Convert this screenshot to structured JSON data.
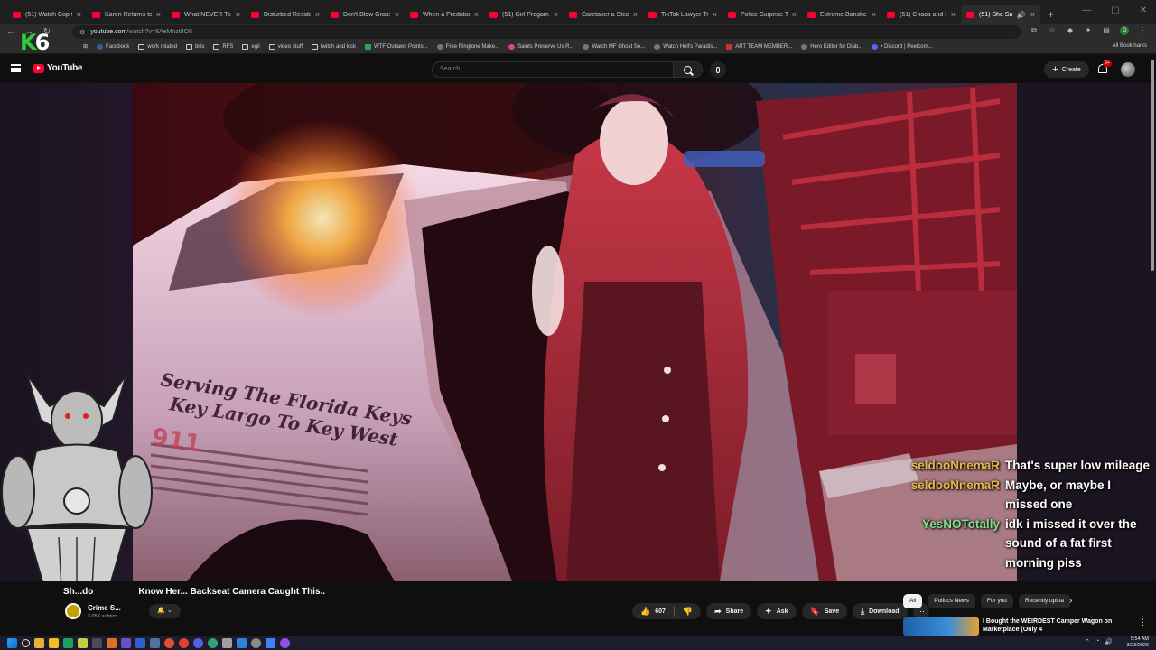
{
  "browser": {
    "tabs": [
      {
        "title": "(51) Watch Cop Cars",
        "active": false
      },
      {
        "title": "Karen Returns to the",
        "active": false
      },
      {
        "title": "What NEVER To Do",
        "active": false
      },
      {
        "title": "Disturbed Resident",
        "active": false
      },
      {
        "title": "Don't Blow Grass C",
        "active": false
      },
      {
        "title": "When a Predator Gr",
        "active": false
      },
      {
        "title": "(51) Girl Pregames",
        "active": false
      },
      {
        "title": "Caretaker a Steals",
        "active": false
      },
      {
        "title": "TikTok Lawyer Tries",
        "active": false
      },
      {
        "title": "Police Surprise Tow",
        "active": false
      },
      {
        "title": "Extreme Banshee K",
        "active": false
      },
      {
        "title": "(51) Chaos and Kare",
        "active": false
      },
      {
        "title": "(51) She Said Sh",
        "active": true
      }
    ],
    "url_domain": "youtube.com",
    "url_path": "/watch?v=8AeMnzt8O8",
    "bookmarks": [
      {
        "label": "Facebook",
        "icon": "facebook-icon",
        "color": "blue"
      },
      {
        "label": "work related",
        "icon": "folder-icon",
        "color": "folder"
      },
      {
        "label": "bills",
        "icon": "folder-icon",
        "color": "folder"
      },
      {
        "label": "RFS",
        "icon": "folder-icon",
        "color": "folder"
      },
      {
        "label": "egil",
        "icon": "folder-icon",
        "color": "folder"
      },
      {
        "label": "video stuff",
        "icon": "folder-icon",
        "color": "folder"
      },
      {
        "label": "twitch and kick",
        "icon": "folder-icon",
        "color": "folder"
      },
      {
        "label": "WTF Outlaws Points...",
        "icon": "site-icon",
        "color": "green"
      },
      {
        "label": "Free Ringtone Make...",
        "icon": "site-icon",
        "color": "gray"
      },
      {
        "label": "Saints Preserve Us R...",
        "icon": "site-icon",
        "color": "pink"
      },
      {
        "label": "Watch MF Ghost Se...",
        "icon": "site-icon",
        "color": "gray"
      },
      {
        "label": "Watch Hell's Paradis...",
        "icon": "site-icon",
        "color": "gray"
      },
      {
        "label": "ART TEAM MEMBER...",
        "icon": "site-icon",
        "color": "red"
      },
      {
        "label": "Hero Editor for Diab...",
        "icon": "site-icon",
        "color": "gray"
      },
      {
        "label": "• Discord | Peelcom...",
        "icon": "discord-icon",
        "color": "purple"
      }
    ],
    "all_bookmarks_label": "All Bookmarks",
    "profile_initial": "G"
  },
  "overlay": {
    "badge_k": "K",
    "badge_6": "6"
  },
  "youtube": {
    "logo_text": "YouTube",
    "search_placeholder": "Search",
    "create_label": "Create",
    "notif_count": "9+"
  },
  "video": {
    "car_text_line1": "Serving The Florida Keys",
    "car_text_line2": "Key Largo To Key West",
    "car_number": "911",
    "title_prefix": "Sh...do",
    "title_suffix": "Know Her... Backseat Camera Caught This..",
    "channel_name": "Crime S...",
    "channel_subs": "3.05K subscri...",
    "likes": "607",
    "share_label": "Share",
    "ask_label": "Ask",
    "save_label": "Save",
    "download_label": "Download"
  },
  "chat": [
    {
      "user": "seldooNnemaR",
      "color": "#e8b84a",
      "text": "That's super low mileage"
    },
    {
      "user": "seldooNnemaR",
      "color": "#e8b84a",
      "text": "Maybe, or maybe I missed one"
    },
    {
      "user": "YesNOTotally",
      "color": "#7ee08a",
      "text": "idk i missed it over the sound of a fat first morning piss"
    }
  ],
  "sidebar": {
    "chips": [
      {
        "label": "All",
        "active": true
      },
      {
        "label": "Politics News",
        "active": false
      },
      {
        "label": "For you",
        "active": false
      },
      {
        "label": "Recently uploa",
        "active": false
      }
    ],
    "rec_title": "I Bought the WEIRDEST Camper Wagon on Marketplace (Only 4"
  },
  "taskbar": {
    "time": "5:54 AM",
    "date": "3/23/2026"
  }
}
